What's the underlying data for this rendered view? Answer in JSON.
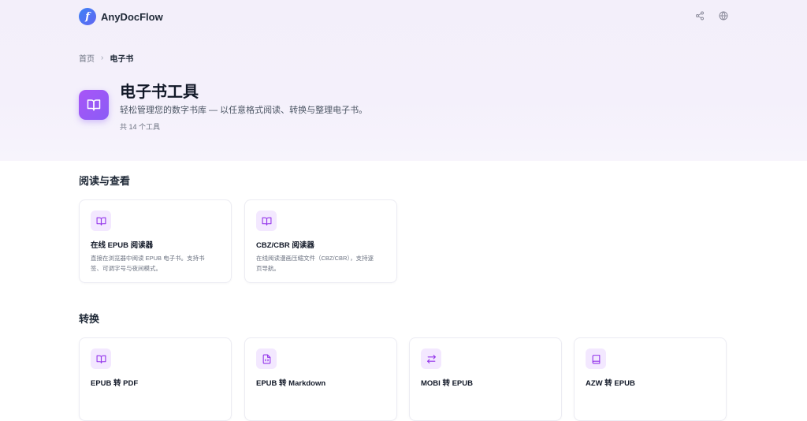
{
  "header": {
    "logo_text": "AnyDocFlow",
    "logo_letter": "f",
    "icons": [
      "share-icon",
      "globe-icon"
    ]
  },
  "breadcrumb": {
    "home": "首页",
    "separator": "›",
    "current": "电子书"
  },
  "hero": {
    "icon": "book-open-icon",
    "title": "电子书工具",
    "description": "轻松管理您的数字书库 — 以任意格式阅读、转换与整理电子书。",
    "count": "共 14 个工具"
  },
  "sections": [
    {
      "title": "阅读与查看",
      "cards": [
        {
          "icon": "book-open-icon",
          "title": "在线 EPUB 阅读器",
          "desc_line1": "直接在浏览器中阅读 EPUB 电子书。支持书",
          "desc_line2": "签、可调字号与夜间模式。"
        },
        {
          "icon": "book-open-icon",
          "title": "CBZ/CBR 阅读器",
          "desc_line1": "在线阅读漫画压缩文件（CBZ/CBR），支持逐",
          "desc_line2": "页导航。"
        }
      ]
    },
    {
      "title": "转换",
      "cards": [
        {
          "icon": "book-open-icon",
          "title": "EPUB 转 PDF"
        },
        {
          "icon": "file-code-icon",
          "title": "EPUB 转 Markdown"
        },
        {
          "icon": "swap-arrows-icon",
          "title": "MOBI 转 EPUB"
        },
        {
          "icon": "book-icon",
          "title": "AZW 转 EPUB"
        }
      ]
    }
  ],
  "colors": {
    "accent": "#8b5cf6",
    "accent_light": "#f3e8ff",
    "icon_stroke": "#9333ea"
  }
}
